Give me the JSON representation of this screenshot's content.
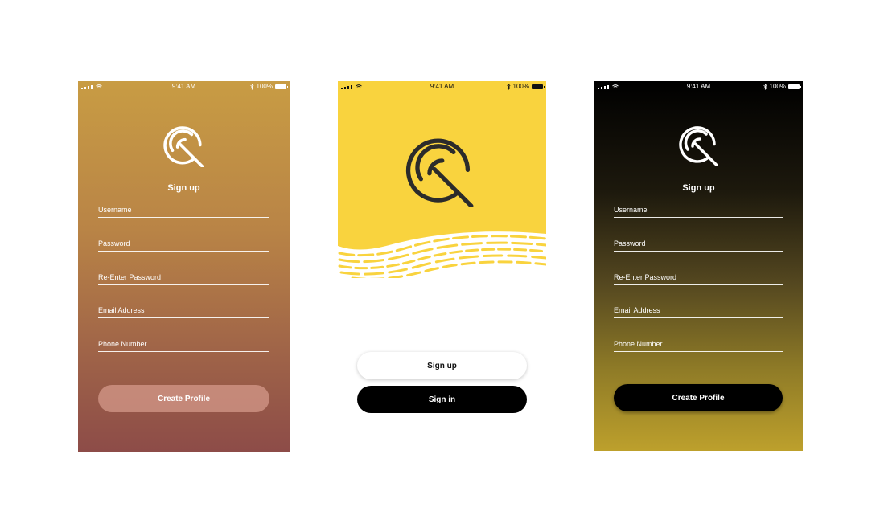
{
  "colors": {
    "accent_yellow": "#f9d33e",
    "mark_dark": "#2b2b2b",
    "screen1_top": "#c89c44",
    "screen1_bottom": "#8d4c48",
    "screen3_top": "#000000",
    "screen3_bottom": "#bda02c",
    "button_black": "#000000",
    "button_muted": "#d79b8c"
  },
  "status_bar": {
    "time": "9:41 AM",
    "battery": "100%",
    "icons": [
      "signal-icon",
      "wifi-icon",
      "bluetooth-icon",
      "battery-icon"
    ]
  },
  "screens": [
    {
      "title": "Sign up",
      "fields": [
        {
          "placeholder": "Username"
        },
        {
          "placeholder": "Password"
        },
        {
          "placeholder": "Re-Enter Password"
        },
        {
          "placeholder": "Email Address"
        },
        {
          "placeholder": "Phone Number"
        }
      ],
      "button": "Create Profile"
    },
    {
      "logo": "radar-search-icon",
      "buttons": {
        "sign_up": "Sign up",
        "sign_in": "Sign in"
      }
    },
    {
      "title": "Sign up",
      "fields": [
        {
          "placeholder": "Username"
        },
        {
          "placeholder": "Password"
        },
        {
          "placeholder": "Re-Enter Password"
        },
        {
          "placeholder": "Email Address"
        },
        {
          "placeholder": "Phone Number"
        }
      ],
      "button": "Create Profile"
    }
  ]
}
